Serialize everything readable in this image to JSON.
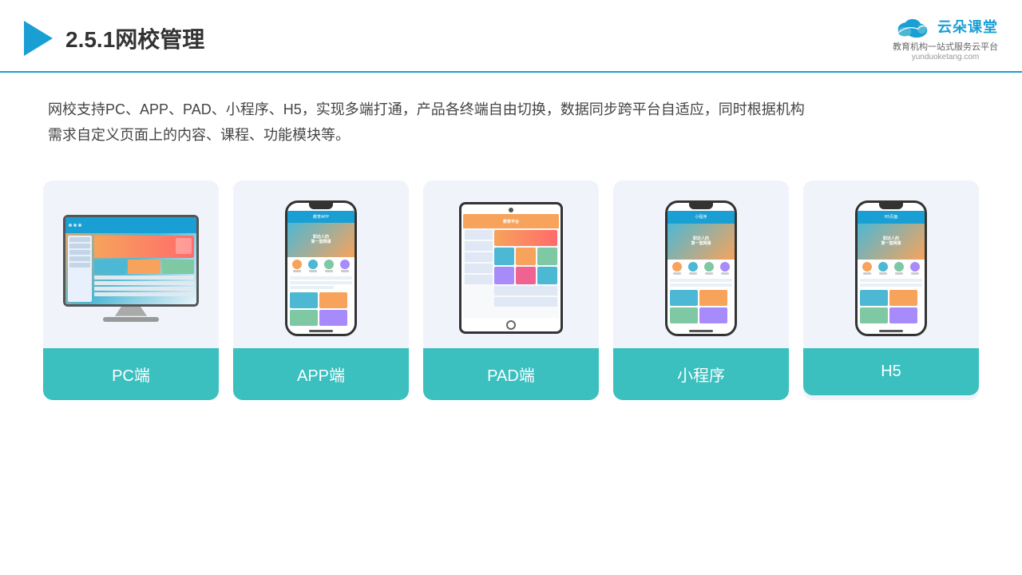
{
  "header": {
    "title": "2.5.1网校管理",
    "logo_text": "云朵课堂",
    "logo_url": "yunduoketang.com",
    "logo_tagline": "教育机构一站\n式服务云平台"
  },
  "description": {
    "line1": "网校支持PC、APP、PAD、小程序、H5，实现多端打通，产品各终端自由切换，数据同步跨平台自适应，同时根据机构",
    "line2": "需求自定义页面上的内容、课程、功能模块等。"
  },
  "cards": [
    {
      "id": "pc",
      "label": "PC端"
    },
    {
      "id": "app",
      "label": "APP端"
    },
    {
      "id": "pad",
      "label": "PAD端"
    },
    {
      "id": "miniprogram",
      "label": "小程序"
    },
    {
      "id": "h5",
      "label": "H5"
    }
  ],
  "accent_color": "#3bbfbf",
  "header_color": "#1a9fd4"
}
